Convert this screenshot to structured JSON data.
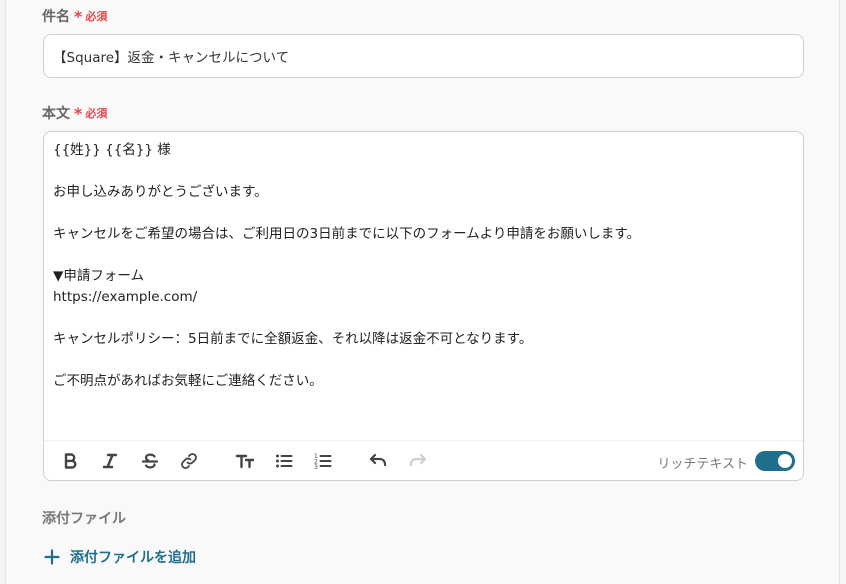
{
  "subject": {
    "label": "件名",
    "required_mark": "*",
    "required_text": "必須",
    "value": "【Square】返金・キャンセルについて"
  },
  "body": {
    "label": "本文",
    "required_mark": "*",
    "required_text": "必須",
    "lines": [
      "{{姓}} {{名}} 様",
      "",
      "お申し込みありがとうございます。",
      "",
      "キャンセルをご希望の場合は、ご利用日の3日前までに以下のフォームより申請をお願いします。",
      "",
      "▼申請フォーム",
      "https://example.com/",
      "",
      "キャンセルポリシー：5日前までに全額返金、それ以降は返金不可となります。",
      "",
      "ご不明点があればお気軽にご連絡ください。"
    ]
  },
  "toolbar": {
    "icons": [
      "bold-icon",
      "italic-icon",
      "strikethrough-icon",
      "link-icon",
      "text-size-icon",
      "bullet-list-icon",
      "numbered-list-icon",
      "undo-icon",
      "redo-icon"
    ],
    "rich_text_label": "リッチテキスト",
    "rich_text_enabled": true,
    "toggle_color": "#1f6e8c"
  },
  "attachments": {
    "label": "添付ファイル",
    "add_label": "添付ファイルを追加",
    "accent": "#1f6e8c"
  },
  "colors": {
    "required": "#e5484d"
  }
}
